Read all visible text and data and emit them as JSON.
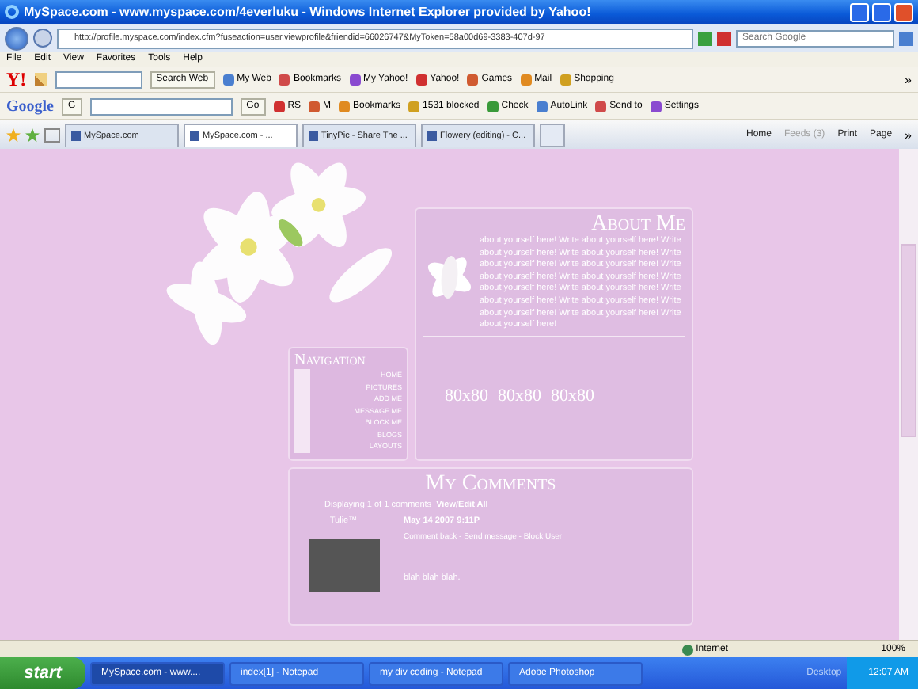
{
  "window": {
    "title": "MySpace.com - www.myspace.com/4everluku - Windows Internet Explorer provided by Yahoo!"
  },
  "address_bar": {
    "url": "http://profile.myspace.com/index.cfm?fuseaction=user.viewprofile&friendid=66026747&MyToken=58a00d69-3383-407d-97"
  },
  "search": {
    "placeholder": "Search Google"
  },
  "menu": [
    "File",
    "Edit",
    "View",
    "Favorites",
    "Tools",
    "Help"
  ],
  "yahoo_toolbar": {
    "logo": "Y!",
    "search_button": "Search Web",
    "items": [
      "My Web",
      "Bookmarks",
      "My Yahoo!",
      "Yahoo!",
      "Games",
      "Mail",
      "Shopping"
    ],
    "more": "»"
  },
  "google_toolbar": {
    "logo": "Google",
    "search_button": "G",
    "go": "Go",
    "items": [
      "RS",
      "M",
      "Bookmarks",
      "1531 blocked",
      "Check",
      "AutoLink",
      "Send to",
      "Settings"
    ]
  },
  "tabs": [
    {
      "label": "MySpace.com",
      "selected": false
    },
    {
      "label": "MySpace.com - ...",
      "selected": true
    },
    {
      "label": "TinyPic - Share The ...",
      "selected": false
    },
    {
      "label": "Flowery (editing) - C...",
      "selected": false
    }
  ],
  "command_bar": {
    "items": [
      {
        "label": "Home",
        "disabled": false
      },
      {
        "label": "Feeds (3)",
        "disabled": true
      },
      {
        "label": "Print",
        "disabled": false
      },
      {
        "label": "Page",
        "disabled": false
      }
    ],
    "more": "»"
  },
  "profile": {
    "navigation": {
      "title": "Navigation",
      "links": [
        "HOME",
        "PICTURES",
        "ADD ME",
        "MESSAGE ME",
        "BLOCK ME",
        "BLOGS",
        "LAYOUTS"
      ]
    },
    "about": {
      "title": "About Me",
      "text": "about yourself here! Write about yourself here! Write about yourself here! Write about yourself here! Write about yourself here! Write about yourself here! Write about yourself here! Write about yourself here! Write about yourself here! Write about yourself here! Write about yourself here! Write about yourself here! Write about yourself here! Write about yourself here! Write about yourself here!"
    },
    "photo_slots": [
      "80x80",
      "80x80",
      "80x80"
    ],
    "comments": {
      "title": "My Comments",
      "summary": "Displaying 1 of 1 comments",
      "view_all": "View/Edit All",
      "items": [
        {
          "author": "Tulie™",
          "date": "May 14 2007 9:11P",
          "actions": "Comment back - Send message - Block User",
          "text": "blah blah blah."
        }
      ]
    }
  },
  "status_bar": {
    "zone": "Internet",
    "zoom": "100%"
  },
  "taskbar": {
    "start": "start",
    "items": [
      {
        "label": "MySpace.com - www....",
        "selected": true
      },
      {
        "label": "index[1] - Notepad",
        "selected": false
      },
      {
        "label": "my div coding - Notepad",
        "selected": false
      },
      {
        "label": "Adobe Photoshop",
        "selected": false
      }
    ],
    "desktop": "Desktop",
    "clock": "12:07 AM"
  }
}
